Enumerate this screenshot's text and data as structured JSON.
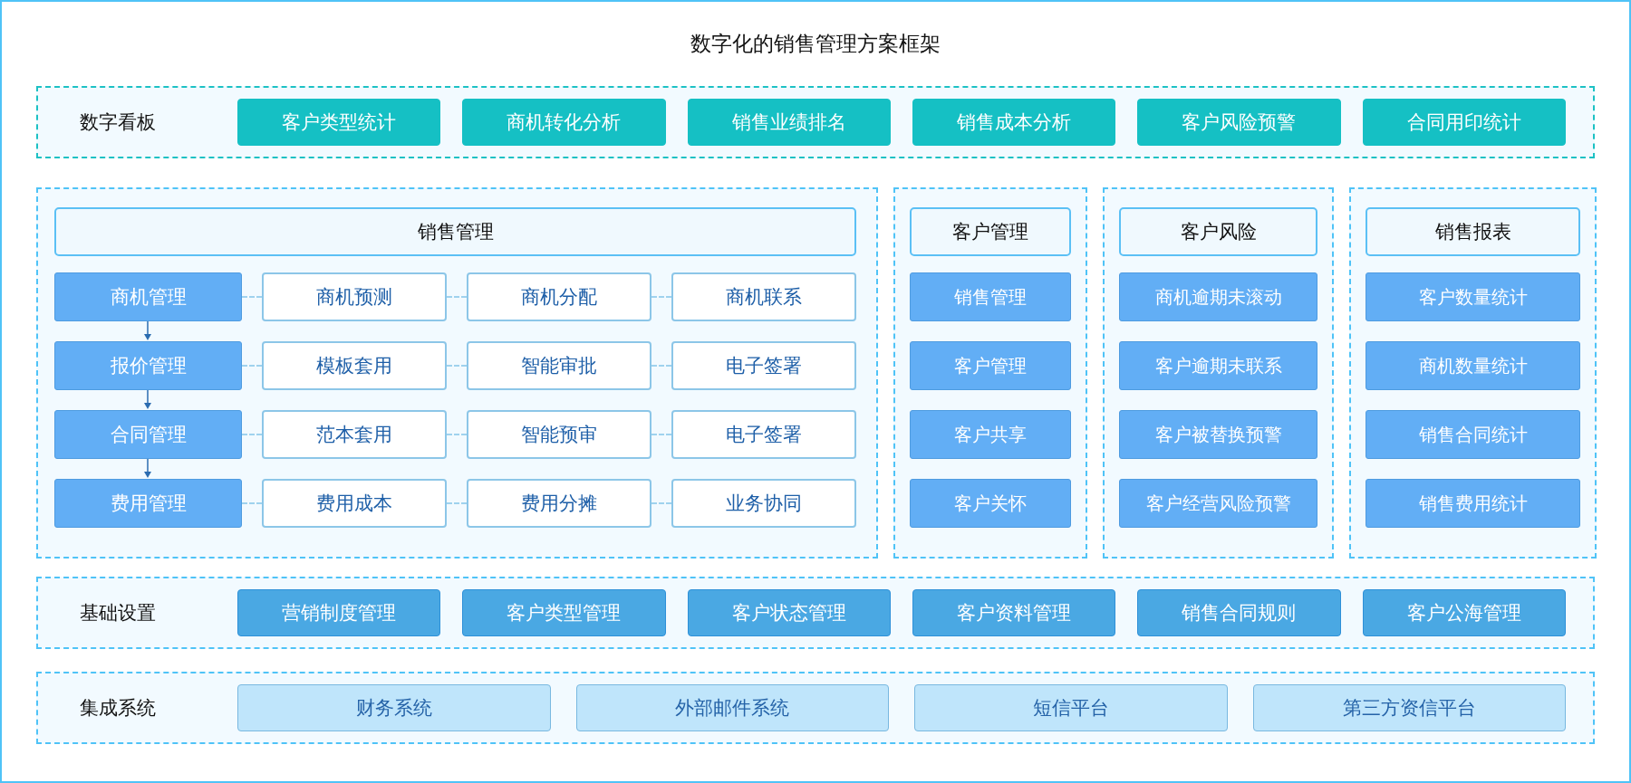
{
  "title": "数字化的销售管理方案框架",
  "dashboard": {
    "label": "数字看板",
    "items": [
      "客户类型统计",
      "商机转化分析",
      "销售业绩排名",
      "销售成本分析",
      "客户风险预警",
      "合同用印统计"
    ]
  },
  "sales_management": {
    "title": "销售管理",
    "rows": [
      {
        "stage": "商机管理",
        "tasks": [
          "商机预测",
          "商机分配",
          "商机联系"
        ]
      },
      {
        "stage": "报价管理",
        "tasks": [
          "模板套用",
          "智能审批",
          "电子签署"
        ]
      },
      {
        "stage": "合同管理",
        "tasks": [
          "范本套用",
          "智能预审",
          "电子签署"
        ]
      },
      {
        "stage": "费用管理",
        "tasks": [
          "费用成本",
          "费用分摊",
          "业务协同"
        ]
      }
    ]
  },
  "side_panels": [
    {
      "title": "客户管理",
      "items": [
        "销售管理",
        "客户管理",
        "客户共享",
        "客户关怀"
      ]
    },
    {
      "title": "客户风险",
      "items": [
        "商机逾期未滚动",
        "客户逾期未联系",
        "客户被替换预警",
        "客户经营风险预警"
      ]
    },
    {
      "title": "销售报表",
      "items": [
        "客户数量统计",
        "商机数量统计",
        "销售合同统计",
        "销售费用统计"
      ]
    }
  ],
  "base_settings": {
    "label": "基础设置",
    "items": [
      "营销制度管理",
      "客户类型管理",
      "客户状态管理",
      "客户资料管理",
      "销售合同规则",
      "客户公海管理"
    ]
  },
  "integrations": {
    "label": "集成系统",
    "items": [
      "财务系统",
      "外部邮件系统",
      "短信平台",
      "第三方资信平台"
    ]
  }
}
